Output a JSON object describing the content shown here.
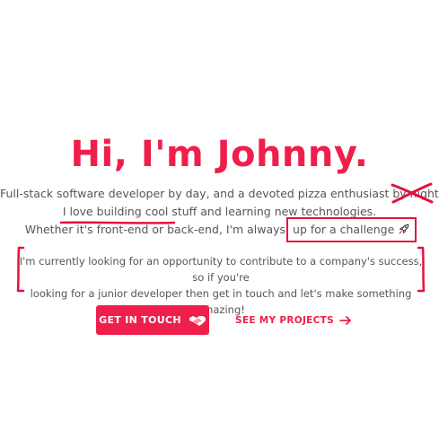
{
  "hero": {
    "title": "Hi, I'm Johnny."
  },
  "intro": {
    "line1_prefix": "Full-stack software developer by day, and a devoted pizza enthusiast ",
    "line1_struck": "by night",
    "line1_suffix": ".",
    "line2_underlined": "I love building cool stuff",
    "line2_suffix": " and learning new technologies.",
    "line3_prefix": "Whether it's front-end or back-end, I'm always ",
    "line3_boxed": "up for a challenge"
  },
  "quote": {
    "line1": "I'm currently looking for an opportunity to contribute to a company's success, so if you're",
    "line2": "looking for a junior developer then get in touch and let's make something amazing!"
  },
  "actions": {
    "contact_label": "GET IN TOUCH",
    "projects_label": "SEE MY PROJECTS"
  },
  "icons": {
    "struck_mark": "cross-mark-icon",
    "rocket": "rocket-icon",
    "contact": "handshake-icon",
    "projects": "arrow-right-icon"
  },
  "colors": {
    "accent": "#ef1f4b",
    "text": "#555555",
    "background": "#ffffff"
  }
}
